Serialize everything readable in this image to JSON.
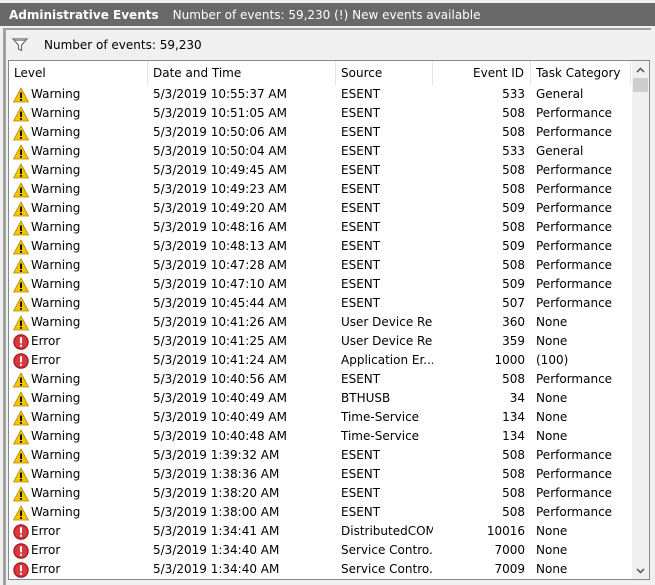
{
  "titlebar": {
    "title": "Administrative Events",
    "status": "Number of events: 59,230 (!) New events available"
  },
  "filterbar": {
    "icon": "filter-funnel-icon",
    "text": "Number of events: 59,230"
  },
  "columns": [
    "Level",
    "Date and Time",
    "Source",
    "Event ID",
    "Task Category"
  ],
  "colors": {
    "titlebar_bg": "#696969",
    "warning": "#f5c400",
    "error": "#c8282c"
  },
  "rows": [
    {
      "level": "Warning",
      "datetime": "5/3/2019 10:55:37 AM",
      "source": "ESENT",
      "event_id": "533",
      "category": "General"
    },
    {
      "level": "Warning",
      "datetime": "5/3/2019 10:51:05 AM",
      "source": "ESENT",
      "event_id": "508",
      "category": "Performance"
    },
    {
      "level": "Warning",
      "datetime": "5/3/2019 10:50:06 AM",
      "source": "ESENT",
      "event_id": "508",
      "category": "Performance"
    },
    {
      "level": "Warning",
      "datetime": "5/3/2019 10:50:04 AM",
      "source": "ESENT",
      "event_id": "533",
      "category": "General"
    },
    {
      "level": "Warning",
      "datetime": "5/3/2019 10:49:45 AM",
      "source": "ESENT",
      "event_id": "508",
      "category": "Performance"
    },
    {
      "level": "Warning",
      "datetime": "5/3/2019 10:49:23 AM",
      "source": "ESENT",
      "event_id": "508",
      "category": "Performance"
    },
    {
      "level": "Warning",
      "datetime": "5/3/2019 10:49:20 AM",
      "source": "ESENT",
      "event_id": "509",
      "category": "Performance"
    },
    {
      "level": "Warning",
      "datetime": "5/3/2019 10:48:16 AM",
      "source": "ESENT",
      "event_id": "508",
      "category": "Performance"
    },
    {
      "level": "Warning",
      "datetime": "5/3/2019 10:48:13 AM",
      "source": "ESENT",
      "event_id": "509",
      "category": "Performance"
    },
    {
      "level": "Warning",
      "datetime": "5/3/2019 10:47:28 AM",
      "source": "ESENT",
      "event_id": "508",
      "category": "Performance"
    },
    {
      "level": "Warning",
      "datetime": "5/3/2019 10:47:10 AM",
      "source": "ESENT",
      "event_id": "509",
      "category": "Performance"
    },
    {
      "level": "Warning",
      "datetime": "5/3/2019 10:45:44 AM",
      "source": "ESENT",
      "event_id": "507",
      "category": "Performance"
    },
    {
      "level": "Warning",
      "datetime": "5/3/2019 10:41:26 AM",
      "source": "User Device Re...",
      "event_id": "360",
      "category": "None"
    },
    {
      "level": "Error",
      "datetime": "5/3/2019 10:41:25 AM",
      "source": "User Device Re...",
      "event_id": "359",
      "category": "None"
    },
    {
      "level": "Error",
      "datetime": "5/3/2019 10:41:24 AM",
      "source": "Application Er...",
      "event_id": "1000",
      "category": "(100)"
    },
    {
      "level": "Warning",
      "datetime": "5/3/2019 10:40:56 AM",
      "source": "ESENT",
      "event_id": "508",
      "category": "Performance"
    },
    {
      "level": "Warning",
      "datetime": "5/3/2019 10:40:49 AM",
      "source": "BTHUSB",
      "event_id": "34",
      "category": "None"
    },
    {
      "level": "Warning",
      "datetime": "5/3/2019 10:40:49 AM",
      "source": "Time-Service",
      "event_id": "134",
      "category": "None"
    },
    {
      "level": "Warning",
      "datetime": "5/3/2019 10:40:48 AM",
      "source": "Time-Service",
      "event_id": "134",
      "category": "None"
    },
    {
      "level": "Warning",
      "datetime": "5/3/2019 1:39:32 AM",
      "source": "ESENT",
      "event_id": "508",
      "category": "Performance"
    },
    {
      "level": "Warning",
      "datetime": "5/3/2019 1:38:36 AM",
      "source": "ESENT",
      "event_id": "508",
      "category": "Performance"
    },
    {
      "level": "Warning",
      "datetime": "5/3/2019 1:38:20 AM",
      "source": "ESENT",
      "event_id": "508",
      "category": "Performance"
    },
    {
      "level": "Warning",
      "datetime": "5/3/2019 1:38:00 AM",
      "source": "ESENT",
      "event_id": "508",
      "category": "Performance"
    },
    {
      "level": "Error",
      "datetime": "5/3/2019 1:34:41 AM",
      "source": "DistributedCOM",
      "event_id": "10016",
      "category": "None"
    },
    {
      "level": "Error",
      "datetime": "5/3/2019 1:34:40 AM",
      "source": "Service Contro...",
      "event_id": "7000",
      "category": "None"
    },
    {
      "level": "Error",
      "datetime": "5/3/2019 1:34:40 AM",
      "source": "Service Contro...",
      "event_id": "7009",
      "category": "None"
    }
  ],
  "scrollbar": {
    "up_icon": "chevron-up-icon",
    "down_icon": "chevron-down-icon"
  }
}
